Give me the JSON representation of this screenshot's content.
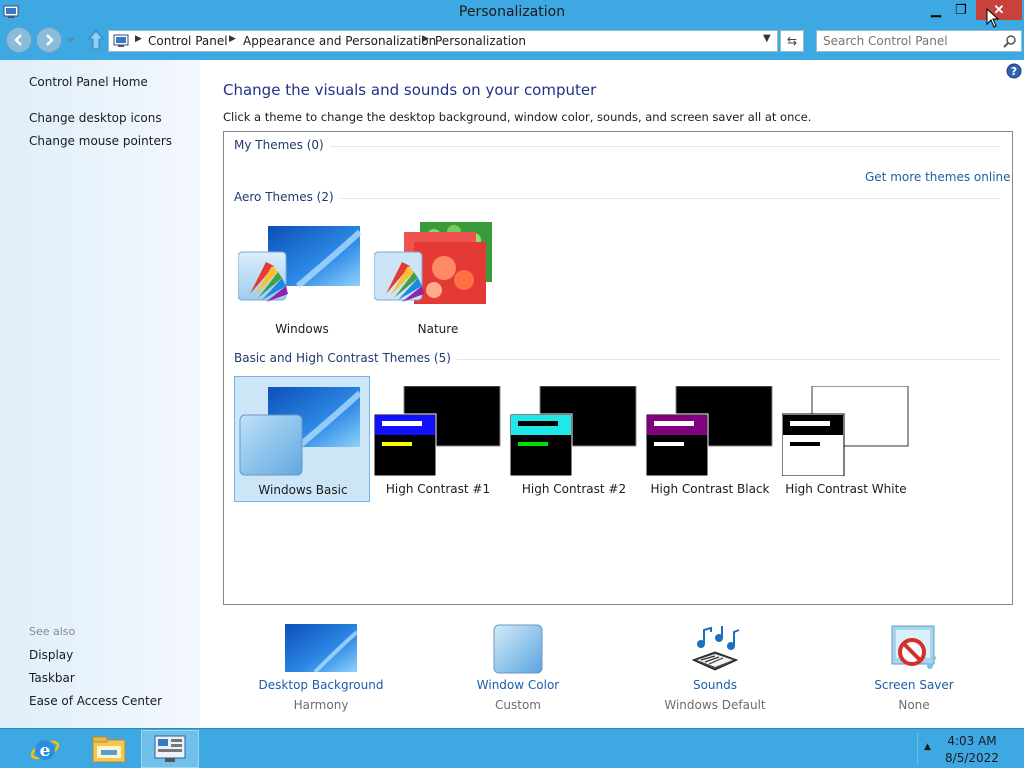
{
  "window": {
    "title": "Personalization",
    "controls": {
      "minimize": "▁",
      "maximize": "❐",
      "close": "✕"
    }
  },
  "address": {
    "crumbs": [
      "Control Panel",
      "Appearance and Personalization",
      "Personalization"
    ],
    "separator": "▶",
    "dropdown": "▼",
    "refresh": "⇆"
  },
  "search": {
    "placeholder": "Search Control Panel"
  },
  "sidebar": {
    "home": "Control Panel Home",
    "links": [
      "Change desktop icons",
      "Change mouse pointers"
    ],
    "see_also_label": "See also",
    "see_also": [
      "Display",
      "Taskbar",
      "Ease of Access Center"
    ]
  },
  "main": {
    "heading": "Change the visuals and sounds on your computer",
    "instruction": "Click a theme to change the desktop background, window color, sounds, and screen saver all at once.",
    "get_more": "Get more themes online",
    "groups": {
      "my": "My Themes (0)",
      "aero": "Aero Themes (2)",
      "basic": "Basic and High Contrast Themes (5)"
    },
    "aero_themes": [
      "Windows",
      "Nature"
    ],
    "basic_themes": [
      "Windows Basic",
      "High Contrast #1",
      "High Contrast #2",
      "High Contrast Black",
      "High Contrast White"
    ],
    "selected_theme": "Windows Basic"
  },
  "settings": [
    {
      "label": "Desktop Background",
      "value": "Harmony",
      "icon": "desktop-background-icon"
    },
    {
      "label": "Window Color",
      "value": "Custom",
      "icon": "window-color-icon"
    },
    {
      "label": "Sounds",
      "value": "Windows Default",
      "icon": "sounds-icon"
    },
    {
      "label": "Screen Saver",
      "value": "None",
      "icon": "screen-saver-icon"
    }
  ],
  "taskbar": {
    "time": "4:03 AM",
    "date": "8/5/2022",
    "tray_arrow": "▲"
  },
  "colors": {
    "chrome": "#3ea8e2",
    "close": "#c7423a",
    "link": "#1a5fa8",
    "heading": "#1e3287",
    "selected_bg": "#cde6f7"
  }
}
